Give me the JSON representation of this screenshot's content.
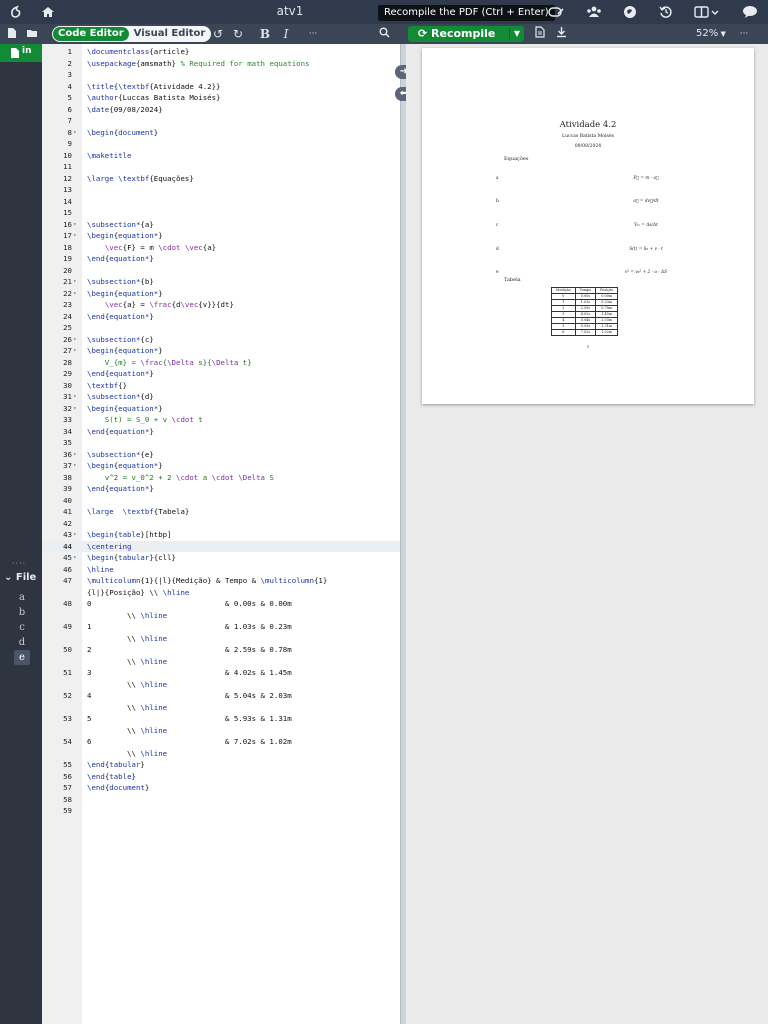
{
  "document": {
    "title": "atv1"
  },
  "topbar": {
    "tooltip": "Recompile the PDF (Ctrl + Enter)",
    "icons": [
      "overleaf-logo-icon",
      "home-icon",
      "review-icon",
      "share-icon",
      "submit-icon",
      "history-icon",
      "layout-icon",
      "chat-icon"
    ]
  },
  "toolbar": {
    "code_editor_label": "Code Editor",
    "visual_editor_label": "Visual Editor",
    "undo_symbol": "↺",
    "redo_symbol": "↻",
    "bold_symbol": "B",
    "italic_symbol": "I",
    "more_symbol": "···",
    "recompile_label": "Recompile",
    "zoom": "52%",
    "pdf_more": "···"
  },
  "sidebar": {
    "outline_label": "File",
    "outline_items": [
      "a",
      "b",
      "c",
      "d",
      "e"
    ],
    "active_item": "e"
  },
  "editor": {
    "highlighted_line": 44,
    "lines": [
      {
        "n": "1",
        "t": "\\documentclass{article}"
      },
      {
        "n": "2",
        "t": "\\usepackage{amsmath} % Required for math equations"
      },
      {
        "n": "3",
        "t": ""
      },
      {
        "n": "4",
        "t": "\\title{\\textbf{Atividade 4.2}}"
      },
      {
        "n": "5",
        "t": "\\author{Luccas Batista Moisés}"
      },
      {
        "n": "6",
        "t": "\\date{09/08/2024}"
      },
      {
        "n": "7",
        "t": ""
      },
      {
        "n": "8",
        "t": "\\begin{document}",
        "fold": true
      },
      {
        "n": "9",
        "t": ""
      },
      {
        "n": "10",
        "t": "\\maketitle"
      },
      {
        "n": "11",
        "t": ""
      },
      {
        "n": "12",
        "t": "\\large \\textbf{Equações}"
      },
      {
        "n": "13",
        "t": ""
      },
      {
        "n": "14",
        "t": ""
      },
      {
        "n": "15",
        "t": ""
      },
      {
        "n": "16",
        "t": "\\subsection*{a}",
        "fold": true
      },
      {
        "n": "17",
        "t": "\\begin{equation*}",
        "fold": true
      },
      {
        "n": "18",
        "t": "    \\vec{F} = m \\cdot \\vec{a}"
      },
      {
        "n": "19",
        "t": "\\end{equation*}"
      },
      {
        "n": "20",
        "t": ""
      },
      {
        "n": "21",
        "t": "\\subsection*{b}",
        "fold": true
      },
      {
        "n": "22",
        "t": "\\begin{equation*}",
        "fold": true
      },
      {
        "n": "23",
        "t": "    \\vec{a} = \\frac{d\\vec{v}}{dt}"
      },
      {
        "n": "24",
        "t": "\\end{equation*}"
      },
      {
        "n": "25",
        "t": ""
      },
      {
        "n": "26",
        "t": "\\subsection*{c}",
        "fold": true
      },
      {
        "n": "27",
        "t": "\\begin{equation*}",
        "fold": true
      },
      {
        "n": "28",
        "t": "    V_{m} = \\frac{\\Delta s}{\\Delta t}"
      },
      {
        "n": "29",
        "t": "\\end{equation*}"
      },
      {
        "n": "30",
        "t": "\\textbf{}"
      },
      {
        "n": "31",
        "t": "\\subsection*{d}",
        "fold": true
      },
      {
        "n": "32",
        "t": "\\begin{equation*}",
        "fold": true
      },
      {
        "n": "33",
        "t": "    S(t) = S_0 + v \\cdot t"
      },
      {
        "n": "34",
        "t": "\\end{equation*}"
      },
      {
        "n": "35",
        "t": ""
      },
      {
        "n": "36",
        "t": "\\subsection*{e}",
        "fold": true
      },
      {
        "n": "37",
        "t": "\\begin{equation*}",
        "fold": true
      },
      {
        "n": "38",
        "t": "    v^2 = v_0^2 + 2 \\cdot a \\cdot \\Delta S"
      },
      {
        "n": "39",
        "t": "\\end{equation*}"
      },
      {
        "n": "40",
        "t": ""
      },
      {
        "n": "41",
        "t": "\\large  \\textbf{Tabela}"
      },
      {
        "n": "42",
        "t": ""
      },
      {
        "n": "43",
        "t": "\\begin{table}[htbp]",
        "fold": true
      },
      {
        "n": "44",
        "t": "\\centering"
      },
      {
        "n": "45",
        "t": "\\begin{tabular}{cll}",
        "fold": true
      },
      {
        "n": "46",
        "t": "\\hline"
      },
      {
        "n": "47",
        "t": "\\multicolumn{1}{|l}{Medição} & Tempo & \\multicolumn{1}"
      },
      {
        "n": "",
        "t": "{l|}{Posição} \\\\ \\hline"
      },
      {
        "n": "48",
        "t": "0                              & 0.00s & 0.00m"
      },
      {
        "n": "",
        "t": "         \\\\ \\hline"
      },
      {
        "n": "49",
        "t": "1                              & 1.03s & 0.23m"
      },
      {
        "n": "",
        "t": "         \\\\ \\hline"
      },
      {
        "n": "50",
        "t": "2                              & 2.59s & 0.78m"
      },
      {
        "n": "",
        "t": "         \\\\ \\hline"
      },
      {
        "n": "51",
        "t": "3                              & 4.02s & 1.45m"
      },
      {
        "n": "",
        "t": "         \\\\ \\hline"
      },
      {
        "n": "52",
        "t": "4                              & 5.04s & 2.03m"
      },
      {
        "n": "",
        "t": "         \\\\ \\hline"
      },
      {
        "n": "53",
        "t": "5                              & 5.93s & 1.31m"
      },
      {
        "n": "",
        "t": "         \\\\ \\hline"
      },
      {
        "n": "54",
        "t": "6                              & 7.02s & 1.02m"
      },
      {
        "n": "",
        "t": "         \\\\ \\hline"
      },
      {
        "n": "55",
        "t": "\\end{tabular}"
      },
      {
        "n": "56",
        "t": "\\end{table}"
      },
      {
        "n": "57",
        "t": "\\end{document}"
      },
      {
        "n": "58",
        "t": ""
      },
      {
        "n": "59",
        "t": ""
      }
    ]
  },
  "pdf": {
    "title": "Atividade 4.2",
    "author": "Luccas Batista Moisés",
    "date": "09/08/2024",
    "section_equations": "Equações",
    "equations": [
      {
        "label": "a",
        "eq": "F⃗ = m · a⃗"
      },
      {
        "label": "b",
        "eq": "a⃗ = dv⃗/dt"
      },
      {
        "label": "c",
        "eq": "Vₘ = Δs/Δt"
      },
      {
        "label": "d",
        "eq": "S(t) = S₀ + v · t"
      },
      {
        "label": "e",
        "eq": "v² = v₀² + 2 · a · ΔS"
      }
    ],
    "section_table": "Tabela",
    "table": {
      "headers": [
        "Medição",
        "Tempo",
        "Posição"
      ],
      "rows": [
        [
          "0",
          "0.00s",
          "0.00m"
        ],
        [
          "1",
          "1.03s",
          "0.23m"
        ],
        [
          "2",
          "2.59s",
          "0.78m"
        ],
        [
          "3",
          "4.02s",
          "1.45m"
        ],
        [
          "4",
          "5.04s",
          "2.03m"
        ],
        [
          "5",
          "5.93s",
          "1.31m"
        ],
        [
          "6",
          "7.02s",
          "1.02m"
        ]
      ]
    },
    "page_number": "1"
  },
  "colors": {
    "accent_green": "#138a36",
    "topbar": "#2f3b4c",
    "toolbar": "#3a4556"
  }
}
